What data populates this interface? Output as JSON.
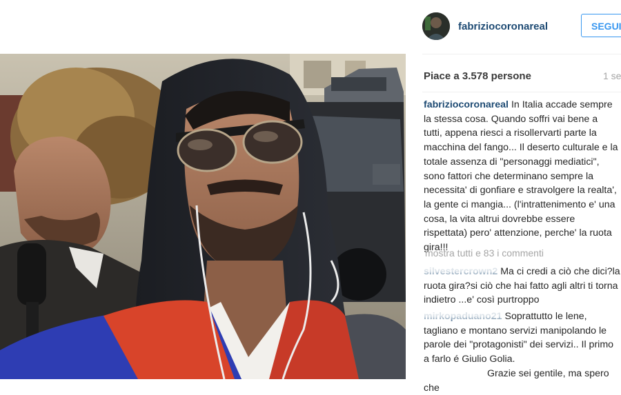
{
  "post": {
    "photo_alt": "selfie",
    "username": "fabriziocoronareal",
    "follow_label": "SEGUI",
    "likes": "Piace a 3.578 persone",
    "time": "1 se",
    "caption_text": "In Italia accade sempre la stessa cosa. Quando soffri vai bene a tutti, appena riesci a risollervarti parte la macchina del fango... Il deserto culturale e la totale assenza di \"personaggi mediatici\", sono fattori che determinano sempre la necessita' di gonfiare e stravolgere la realta', la gente ci mangia... (l'intrattenimento e' una cosa, la vita altrui dovrebbe essere rispettata) pero' attenzione, perche' la ruota gira!!!",
    "show_all_comments": "mostra tutti e 83 i commenti"
  },
  "comments": [
    {
      "user": "silvestercrown2",
      "text": "Ma ci credi a ciò che dici?la ruota gira?si ciò che hai fatto agli altri ti torna indietro ...e' così purtroppo"
    },
    {
      "user": "mirkopaduano21",
      "text": "Soprattutto le lene, tagliano e montano servizi manipolando le parole dei \"protagonisti\" dei servizi.. Il primo a farlo é Giulio Golia."
    },
    {
      "user": "",
      "text": "Grazie sei gentile, ma spero che"
    }
  ],
  "colors": {
    "username_blue": "#1d4a73",
    "follow_blue": "#3897f0",
    "muted_grey": "#a5a5a5"
  }
}
